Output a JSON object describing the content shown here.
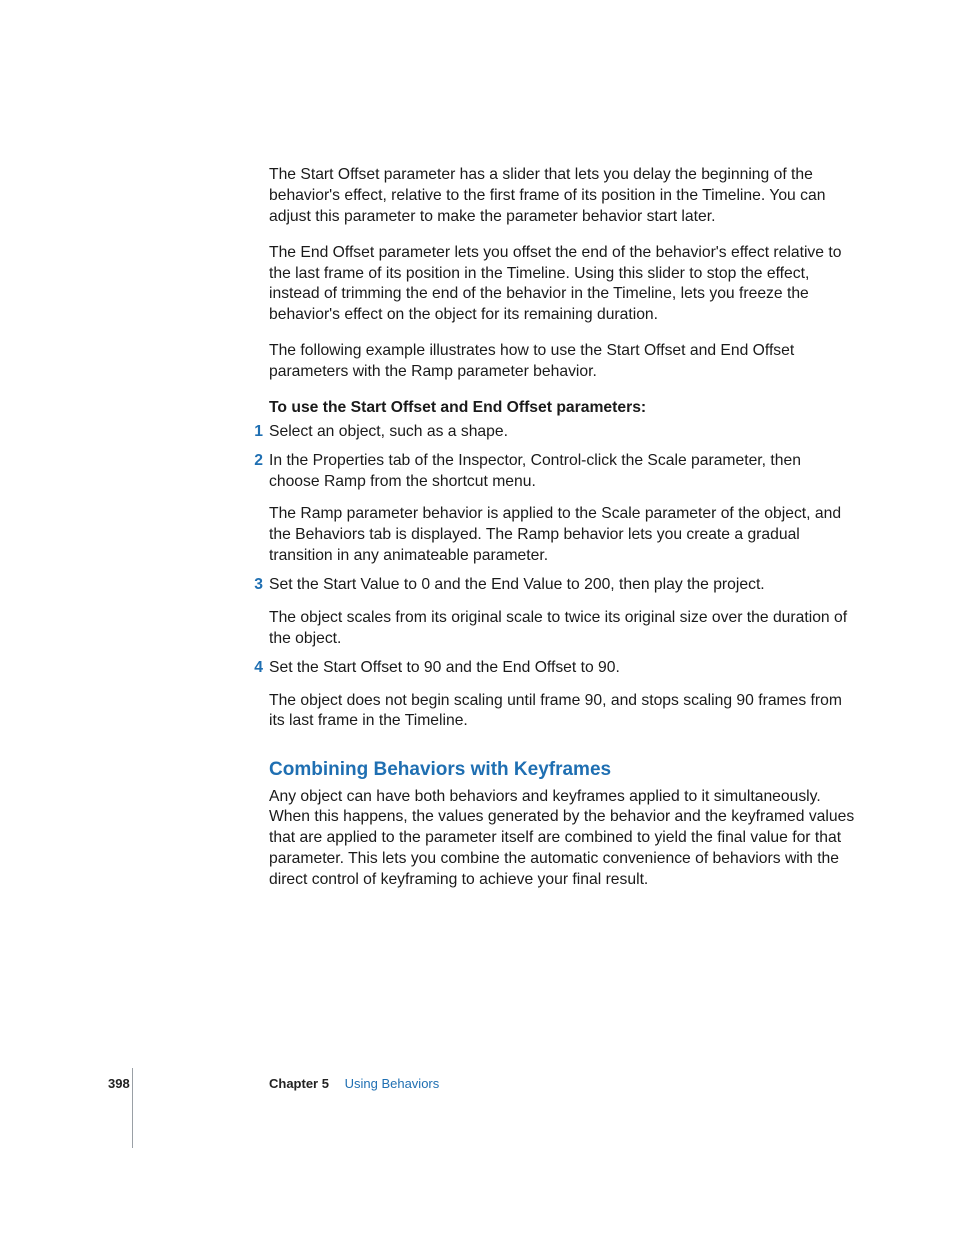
{
  "paragraphs": {
    "p1": "The Start Offset parameter has a slider that lets you delay the beginning of the behavior's effect, relative to the first frame of its position in the Timeline. You can adjust this parameter to make the parameter behavior start later.",
    "p2": "The End Offset parameter lets you offset the end of the behavior's effect relative to the last frame of its position in the Timeline. Using this slider to stop the effect, instead of trimming the end of the behavior in the Timeline, lets you freeze the behavior's effect on the object for its remaining duration.",
    "p3": "The following example illustrates how to use the Start Offset and End Offset parameters with the Ramp parameter behavior."
  },
  "procedure_title": "To use the Start Offset and End Offset parameters:",
  "steps": [
    {
      "num": "1",
      "paras": [
        "Select an object, such as a shape."
      ]
    },
    {
      "num": "2",
      "paras": [
        "In the Properties tab of the Inspector, Control-click the Scale parameter, then choose Ramp from the shortcut menu.",
        "The Ramp parameter behavior is applied to the Scale parameter of the object, and the Behaviors tab is displayed. The Ramp behavior lets you create a gradual transition in any animateable parameter."
      ]
    },
    {
      "num": "3",
      "paras": [
        "Set the Start Value to 0 and the End Value to 200, then play the project.",
        "The object scales from its original scale to twice its original size over the duration of the object."
      ]
    },
    {
      "num": "4",
      "paras": [
        "Set the Start Offset to 90 and the End Offset to 90.",
        "The object does not begin scaling until frame 90, and stops scaling 90 frames from its last frame in the Timeline."
      ]
    }
  ],
  "section_heading": "Combining Behaviors with Keyframes",
  "section_body": "Any object can have both behaviors and keyframes applied to it simultaneously. When this happens, the values generated by the behavior and the keyframed values that are applied to the parameter itself are combined to yield the final value for that parameter. This lets you combine the automatic convenience of behaviors with the direct control of keyframing to achieve your final result.",
  "footer": {
    "page_number": "398",
    "chapter_label": "Chapter 5",
    "chapter_title": "Using Behaviors"
  }
}
